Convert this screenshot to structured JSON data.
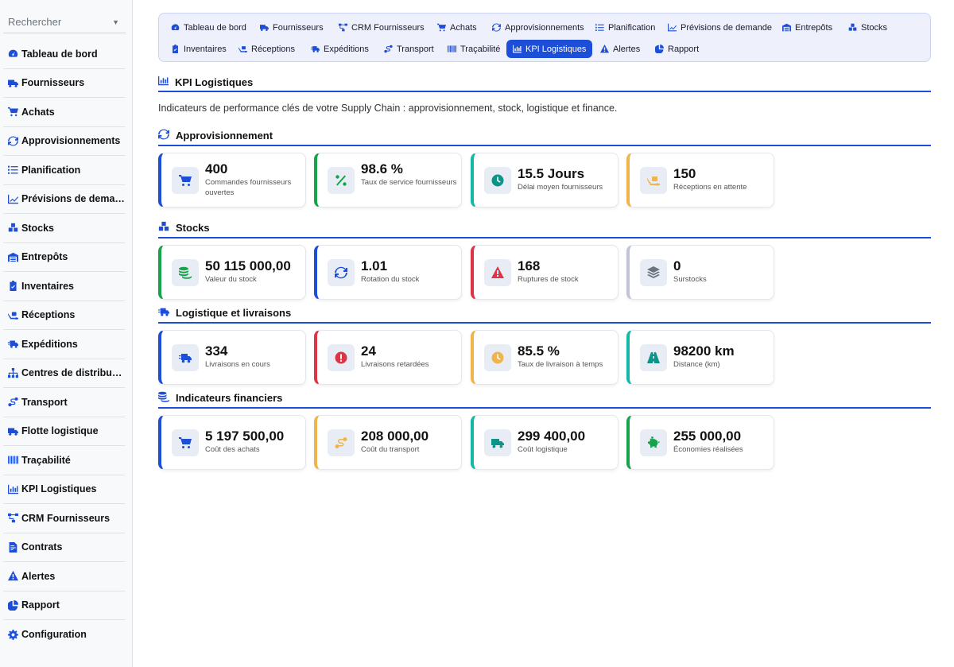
{
  "search": {
    "placeholder": "Rechercher"
  },
  "sidebar": {
    "items": [
      {
        "label": "Tableau de bord",
        "icon": "gauge-icon"
      },
      {
        "label": "Fournisseurs",
        "icon": "truck-icon"
      },
      {
        "label": "Achats",
        "icon": "cart-icon"
      },
      {
        "label": "Approvisionnements",
        "icon": "sync-icon"
      },
      {
        "label": "Planification",
        "icon": "list-icon"
      },
      {
        "label": "Prévisions de demande",
        "icon": "chart-line-icon"
      },
      {
        "label": "Stocks",
        "icon": "boxes-icon"
      },
      {
        "label": "Entrepôts",
        "icon": "warehouse-icon"
      },
      {
        "label": "Inventaires",
        "icon": "clipboard-check-icon"
      },
      {
        "label": "Réceptions",
        "icon": "truck-ramp-icon"
      },
      {
        "label": "Expéditions",
        "icon": "truck-fast-icon"
      },
      {
        "label": "Centres de distribution",
        "icon": "sitemap-icon"
      },
      {
        "label": "Transport",
        "icon": "route-icon"
      },
      {
        "label": "Flotte logistique",
        "icon": "truck-icon"
      },
      {
        "label": "Traçabilité",
        "icon": "barcode-icon"
      },
      {
        "label": "KPI Logistiques",
        "icon": "chart-bar-icon"
      },
      {
        "label": "CRM Fournisseurs",
        "icon": "network-icon"
      },
      {
        "label": "Contrats",
        "icon": "contract-icon"
      },
      {
        "label": "Alertes",
        "icon": "warning-icon"
      },
      {
        "label": "Rapport",
        "icon": "pie-icon"
      },
      {
        "label": "Configuration",
        "icon": "gear-icon"
      }
    ]
  },
  "topnav": {
    "items": [
      {
        "label": "Tableau de bord",
        "icon": "gauge-icon"
      },
      {
        "label": "Fournisseurs",
        "icon": "truck-icon"
      },
      {
        "label": "CRM Fournisseurs",
        "icon": "network-icon"
      },
      {
        "label": "Achats",
        "icon": "cart-icon"
      },
      {
        "label": "Approvisionnements",
        "icon": "sync-icon"
      },
      {
        "label": "Planification",
        "icon": "list-icon"
      },
      {
        "label": "Prévisions de demande",
        "icon": "chart-line-icon"
      },
      {
        "label": "Entrepôts",
        "icon": "warehouse-icon"
      },
      {
        "label": "Stocks",
        "icon": "boxes-icon"
      },
      {
        "label": "Inventaires",
        "icon": "clipboard-check-icon"
      },
      {
        "label": "Réceptions",
        "icon": "truck-ramp-icon"
      },
      {
        "label": "Expéditions",
        "icon": "truck-fast-icon"
      },
      {
        "label": "Transport",
        "icon": "route-icon"
      },
      {
        "label": "Traçabilité",
        "icon": "barcode-icon"
      },
      {
        "label": "KPI Logistiques",
        "icon": "chart-bar-icon",
        "active": true
      },
      {
        "label": "Alertes",
        "icon": "warning-icon"
      },
      {
        "label": "Rapport",
        "icon": "pie-icon"
      }
    ]
  },
  "page": {
    "title": "KPI Logistiques",
    "description": "Indicateurs de performance clés de votre Supply Chain : approvisionnement, stock, logistique et finance."
  },
  "sections": [
    {
      "title": "Approvisionnement",
      "icon": "sync-icon",
      "cards": [
        {
          "value": "400",
          "label": "Commandes fournisseurs ouvertes",
          "icon": "cart-icon",
          "accent": "#1d4ed8",
          "icon_color": "#1d4ed8"
        },
        {
          "value": "98.6 %",
          "label": "Taux de service fournisseurs",
          "icon": "percent-icon",
          "accent": "#16a34a",
          "icon_color": "#16a34a"
        },
        {
          "value": "15.5 Jours",
          "label": "Délai moyen fournisseurs",
          "icon": "clock-icon",
          "accent": "#14b8a6",
          "icon_color": "#0d9488"
        },
        {
          "value": "150",
          "label": "Réceptions en attente",
          "icon": "truck-ramp-icon",
          "accent": "#f0b44c",
          "icon_color": "#f0b44c"
        }
      ]
    },
    {
      "title": "Stocks",
      "icon": "boxes-icon",
      "cards": [
        {
          "value": "50 115 000,00",
          "label": "Valeur du stock",
          "icon": "coins-icon",
          "accent": "#16a34a",
          "icon_color": "#16a34a"
        },
        {
          "value": "1.01",
          "label": "Rotation du stock",
          "icon": "sync-icon",
          "accent": "#1d4ed8",
          "icon_color": "#1d4ed8"
        },
        {
          "value": "168",
          "label": "Ruptures de stock",
          "icon": "warning-icon",
          "accent": "#dc3545",
          "icon_color": "#dc3545"
        },
        {
          "value": "0",
          "label": "Surstocks",
          "icon": "layers-icon",
          "accent": "#c0c4d6",
          "icon_color": "#6b7280"
        }
      ]
    },
    {
      "title": "Logistique et livraisons",
      "icon": "truck-fast-icon",
      "cards": [
        {
          "value": "334",
          "label": "Livraisons en cours",
          "icon": "truck-fast-icon",
          "accent": "#1d4ed8",
          "icon_color": "#1d4ed8"
        },
        {
          "value": "24",
          "label": "Livraisons retardées",
          "icon": "alert-circle-icon",
          "accent": "#dc3545",
          "icon_color": "#dc3545"
        },
        {
          "value": "85.5 %",
          "label": "Taux de livraison à temps",
          "icon": "clock-icon",
          "accent": "#f0b44c",
          "icon_color": "#f0b44c"
        },
        {
          "value": "98200 km",
          "label": "Distance (km)",
          "icon": "road-icon",
          "accent": "#14b8a6",
          "icon_color": "#0d9488"
        }
      ]
    },
    {
      "title": "Indicateurs financiers",
      "icon": "coins-icon",
      "cards": [
        {
          "value": "5 197 500,00",
          "label": "Coût des achats",
          "icon": "cart-icon",
          "accent": "#1d4ed8",
          "icon_color": "#1d4ed8"
        },
        {
          "value": "208 000,00",
          "label": "Coût du transport",
          "icon": "route-icon",
          "accent": "#f0b44c",
          "icon_color": "#f0b44c"
        },
        {
          "value": "299 400,00",
          "label": "Coût logistique",
          "icon": "truck-icon",
          "accent": "#14b8a6",
          "icon_color": "#0d9488"
        },
        {
          "value": "255 000,00",
          "label": "Économies réalisées",
          "icon": "piggy-bank-icon",
          "accent": "#16a34a",
          "icon_color": "#16a34a"
        }
      ]
    }
  ],
  "colors": {
    "primary": "#1d4ed8",
    "nav_bg": "#eef0fc",
    "sidebar_bg": "#f8f9fa"
  }
}
